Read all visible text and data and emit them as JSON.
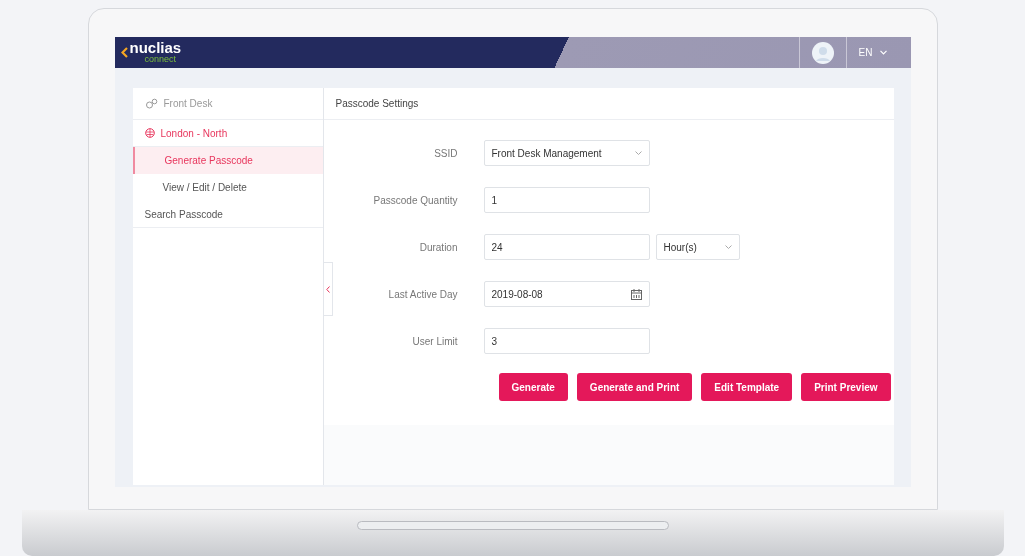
{
  "brand": {
    "name": "nuclias",
    "tagline": "connect"
  },
  "header": {
    "language": "EN"
  },
  "sidebar": {
    "title": "Front Desk",
    "site": "London - North",
    "items": [
      {
        "label": "Generate Passcode",
        "selected": true,
        "kind": "sub"
      },
      {
        "label": "View / Edit / Delete",
        "selected": false,
        "kind": "sub"
      },
      {
        "label": "Search Passcode",
        "selected": false,
        "kind": "top"
      }
    ]
  },
  "panel": {
    "title": "Passcode Settings",
    "fields": [
      {
        "label": "SSID",
        "kind": "select",
        "value": "Front Desk Management"
      },
      {
        "label": "Passcode Quantity",
        "kind": "text",
        "value": "1"
      },
      {
        "label": "Duration",
        "kind": "text",
        "value": "24",
        "unit": "Hour(s)"
      },
      {
        "label": "Last Active Day",
        "kind": "date",
        "value": "2019-08-08"
      },
      {
        "label": "User Limit",
        "kind": "text",
        "value": "3"
      }
    ],
    "buttons": [
      "Generate",
      "Generate and Print",
      "Edit Template",
      "Print Preview"
    ]
  }
}
